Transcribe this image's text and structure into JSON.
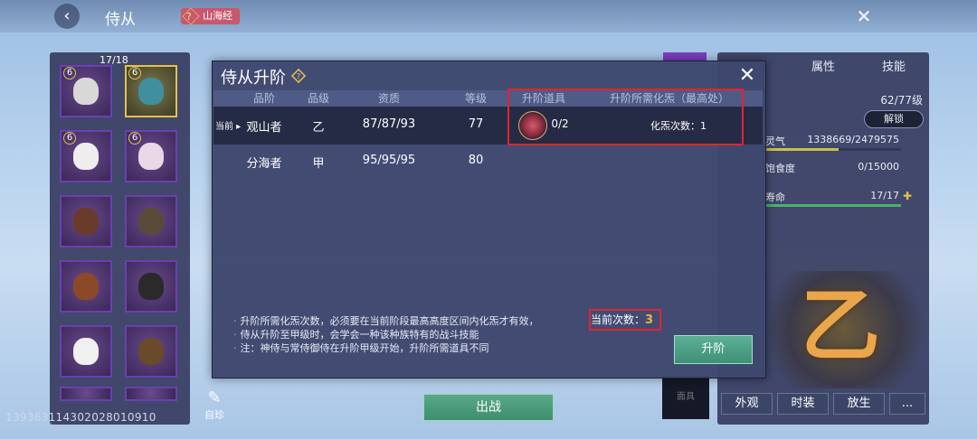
{
  "header": {
    "title": "侍从",
    "tag_label": "山海经"
  },
  "left_panel": {
    "count": "17/18",
    "uid": "13936311430202801091​0"
  },
  "right_panel": {
    "tabs": [
      "属性",
      "技能"
    ],
    "name_value": "62/77级",
    "unlock_label": "解锁",
    "stats": [
      {
        "label": "灵气",
        "value": "1338669/2479575"
      },
      {
        "label": "饱食度",
        "value": "0/15000"
      },
      {
        "label": "寿命",
        "value": "17/17"
      }
    ],
    "emblem_char": "乙",
    "buttons": [
      "外观",
      "时装",
      "放生",
      "..."
    ],
    "mask_label": "面具"
  },
  "center": {
    "deploy_label": "出战",
    "free_label": "自珍"
  },
  "modal": {
    "title": "侍从升阶",
    "columns": [
      "品阶",
      "品级",
      "资质",
      "等级",
      "升阶道具",
      "升阶所需化炁（最高处）"
    ],
    "current_marker": "当前",
    "rows": [
      {
        "rank": "观山者",
        "grade": "乙",
        "aptitude": "87/87/93",
        "level": "77",
        "item_count": "0/2",
        "need": "化炁次数：1"
      },
      {
        "rank": "分海者",
        "grade": "甲",
        "aptitude": "95/95/95",
        "level": "80",
        "item_count": "",
        "need": ""
      }
    ],
    "notes": [
      "升阶所需化炁次数，必须要在当前阶段最高高度区间内化炁才有效，",
      "侍从升阶至甲级时，会学会一种该种族特有的战斗技能",
      "注：神侍与常侍御侍在升阶甲级开始，升阶所需道具不同"
    ],
    "current_count_label": "当前次数：",
    "current_count_value": "3",
    "upgrade_label": "升阶"
  }
}
